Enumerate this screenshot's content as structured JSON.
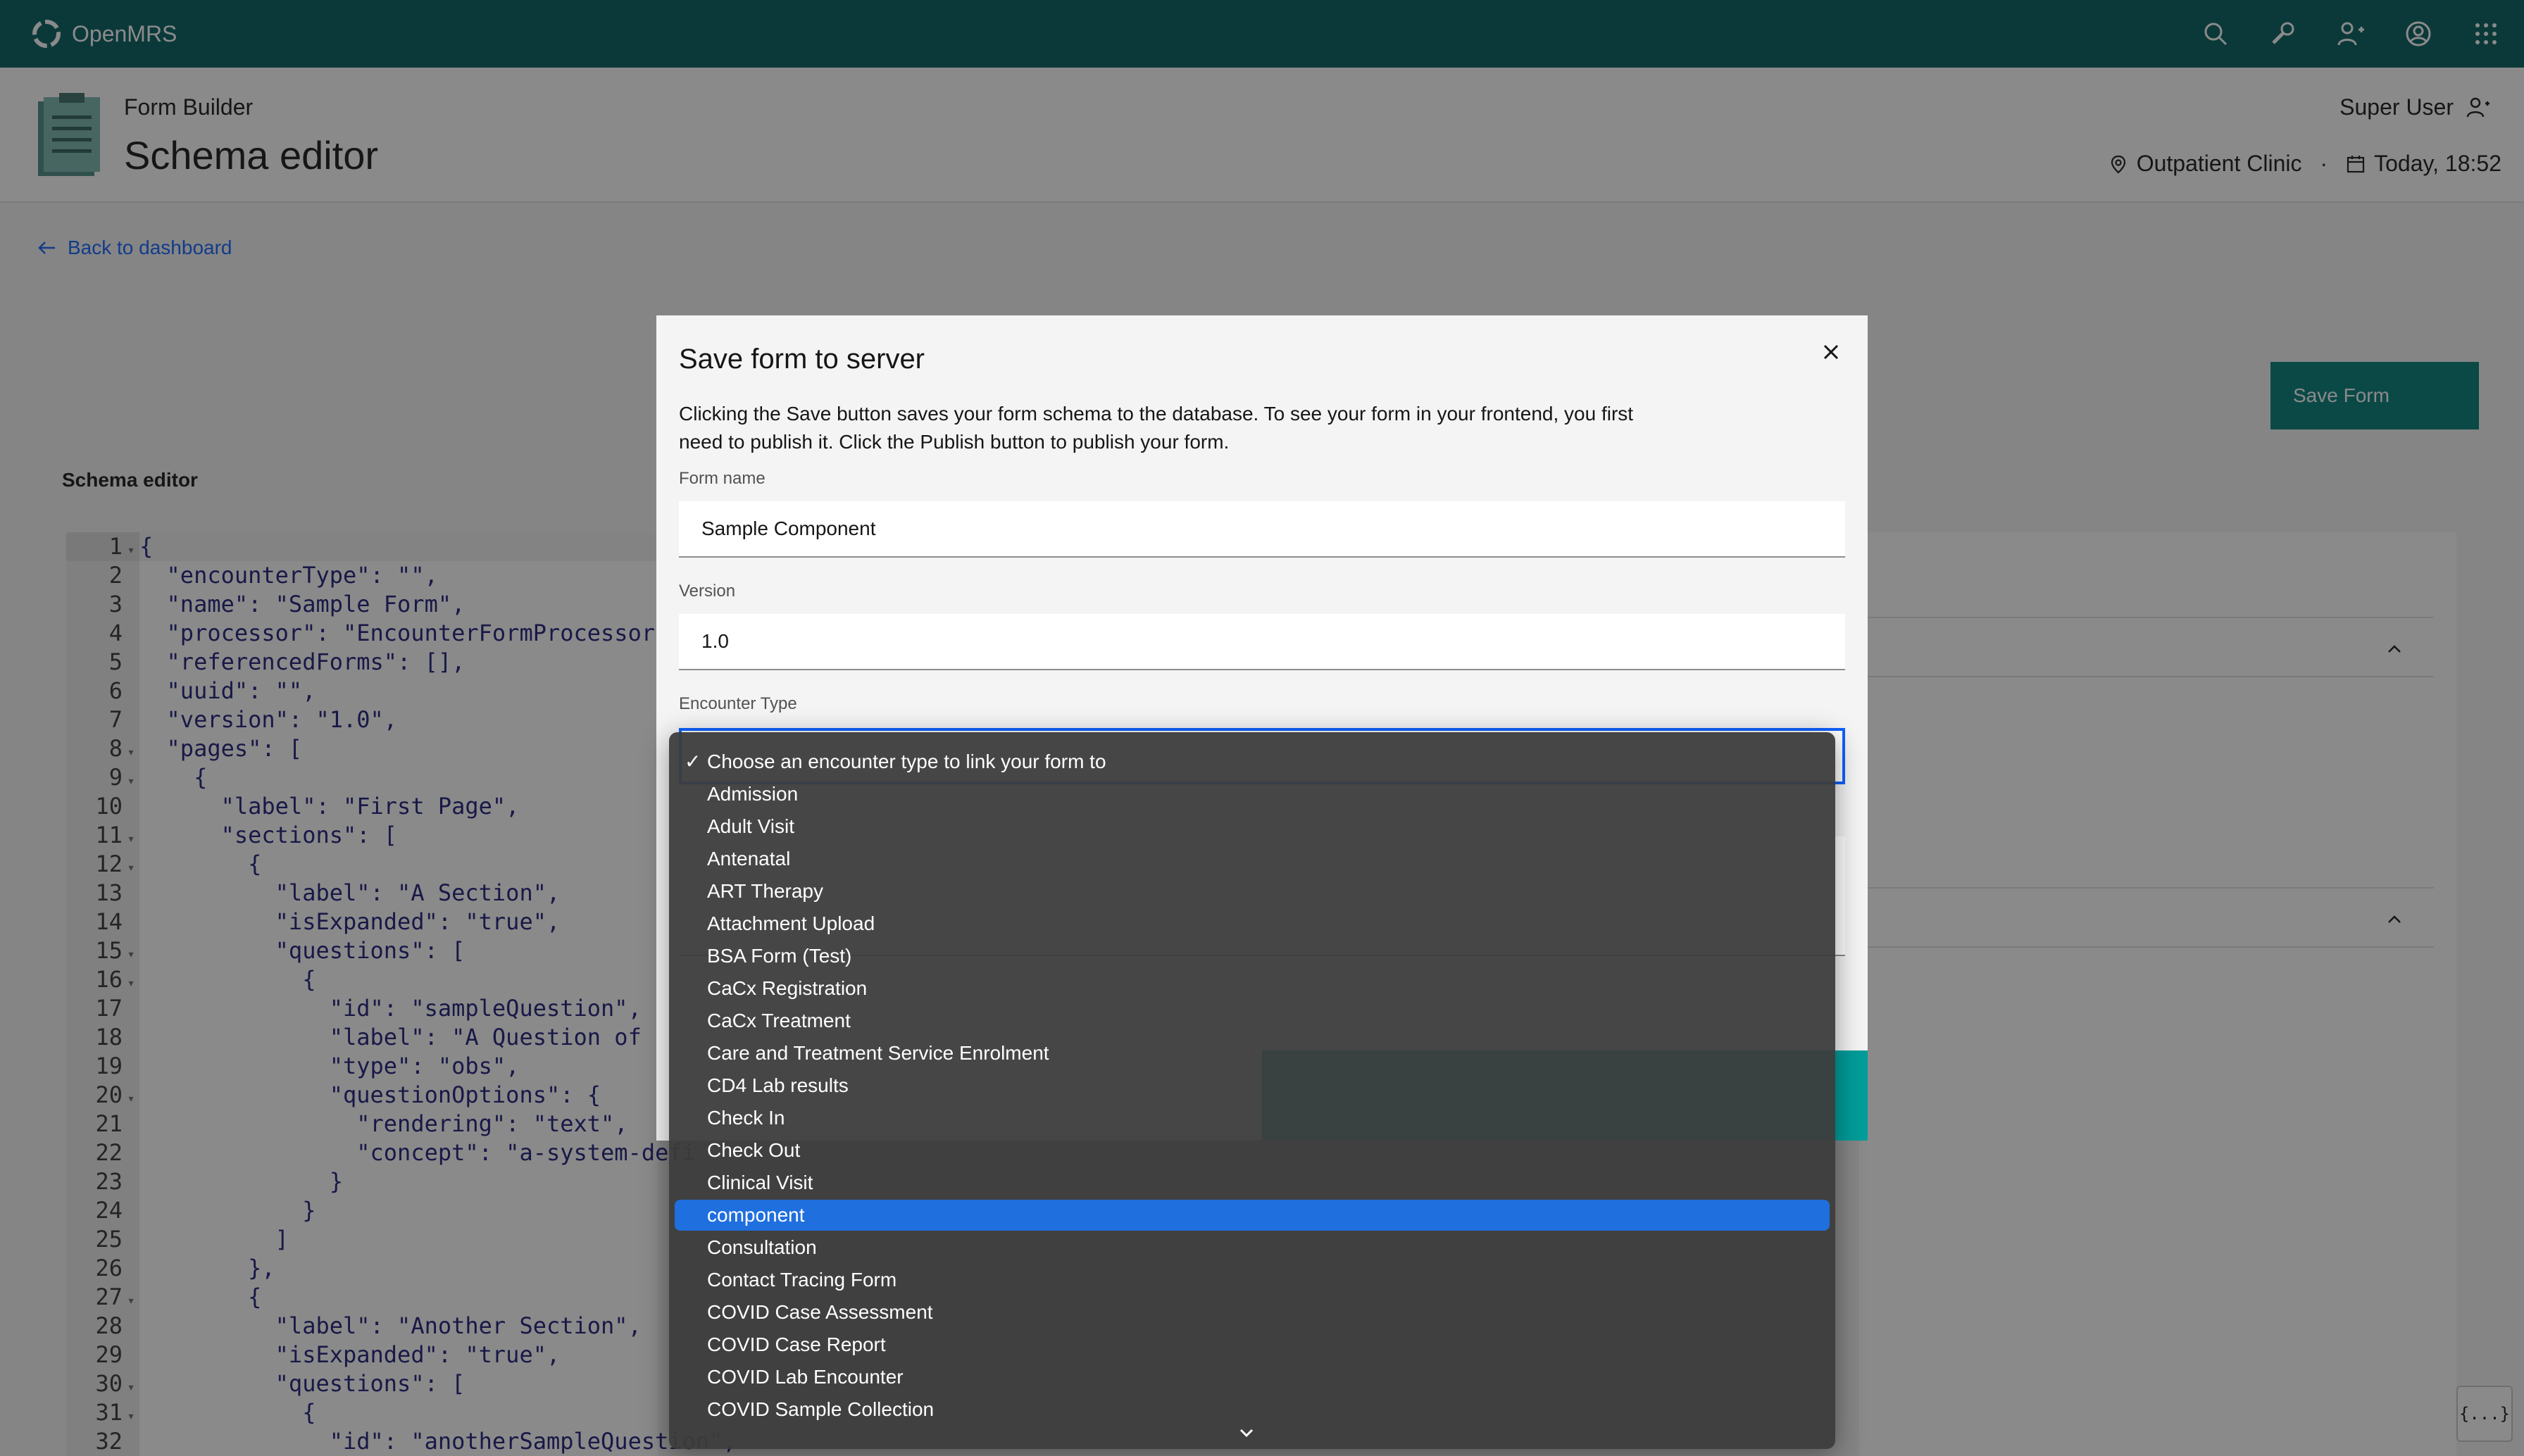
{
  "app": {
    "brand": "OpenMRS",
    "colors": {
      "nav": "#005d5d",
      "accent": "#0f62fe",
      "primary_button": "#007d79",
      "highlight": "#1f6fde"
    }
  },
  "nav": {
    "icons": [
      "search-icon",
      "wrench-icon",
      "add-patient-icon",
      "user-avatar-icon",
      "app-switcher-icon"
    ]
  },
  "header": {
    "subtitle": "Form Builder",
    "title": "Schema editor",
    "user": "Super User",
    "location": "Outpatient Clinic",
    "datetime": "Today, 18:52"
  },
  "page": {
    "back_link": "Back to dashboard",
    "save_form_button": "Save Form",
    "schema_label": "Schema editor"
  },
  "editor": {
    "lines": [
      {
        "n": "1",
        "fold": true,
        "t": "{"
      },
      {
        "n": "2",
        "fold": false,
        "t": "  \"encounterType\": \"\","
      },
      {
        "n": "3",
        "fold": false,
        "t": "  \"name\": \"Sample Form\","
      },
      {
        "n": "4",
        "fold": false,
        "t": "  \"processor\": \"EncounterFormProcessor\","
      },
      {
        "n": "5",
        "fold": false,
        "t": "  \"referencedForms\": [],"
      },
      {
        "n": "6",
        "fold": false,
        "t": "  \"uuid\": \"\","
      },
      {
        "n": "7",
        "fold": false,
        "t": "  \"version\": \"1.0\","
      },
      {
        "n": "8",
        "fold": true,
        "t": "  \"pages\": ["
      },
      {
        "n": "9",
        "fold": true,
        "t": "    {"
      },
      {
        "n": "10",
        "fold": false,
        "t": "      \"label\": \"First Page\","
      },
      {
        "n": "11",
        "fold": true,
        "t": "      \"sections\": ["
      },
      {
        "n": "12",
        "fold": true,
        "t": "        {"
      },
      {
        "n": "13",
        "fold": false,
        "t": "          \"label\": \"A Section\","
      },
      {
        "n": "14",
        "fold": false,
        "t": "          \"isExpanded\": \"true\","
      },
      {
        "n": "15",
        "fold": true,
        "t": "          \"questions\": ["
      },
      {
        "n": "16",
        "fold": true,
        "t": "            {"
      },
      {
        "n": "17",
        "fold": false,
        "t": "              \"id\": \"sampleQuestion\","
      },
      {
        "n": "18",
        "fold": false,
        "t": "              \"label\": \"A Question of ty"
      },
      {
        "n": "19",
        "fold": false,
        "t": "              \"type\": \"obs\","
      },
      {
        "n": "20",
        "fold": true,
        "t": "              \"questionOptions\": {"
      },
      {
        "n": "21",
        "fold": false,
        "t": "                \"rendering\": \"text\","
      },
      {
        "n": "22",
        "fold": false,
        "t": "                \"concept\": \"a-system-defi"
      },
      {
        "n": "23",
        "fold": false,
        "t": "              }"
      },
      {
        "n": "24",
        "fold": false,
        "t": "            }"
      },
      {
        "n": "25",
        "fold": false,
        "t": "          ]"
      },
      {
        "n": "26",
        "fold": false,
        "t": "        },"
      },
      {
        "n": "27",
        "fold": true,
        "t": "        {"
      },
      {
        "n": "28",
        "fold": false,
        "t": "          \"label\": \"Another Section\","
      },
      {
        "n": "29",
        "fold": false,
        "t": "          \"isExpanded\": \"true\","
      },
      {
        "n": "30",
        "fold": true,
        "t": "          \"questions\": ["
      },
      {
        "n": "31",
        "fold": true,
        "t": "            {"
      },
      {
        "n": "32",
        "fold": false,
        "t": "              \"id\": \"anotherSampleQuestion\","
      }
    ]
  },
  "right_panel": {
    "float_button": "{...}"
  },
  "modal": {
    "title": "Save form to server",
    "description": "Clicking the Save button saves your form schema to the database. To see your form in your frontend, you first need to publish it. Click the Publish button to publish your form.",
    "form_name_label": "Form name",
    "form_name_value": "Sample Component",
    "version_label": "Version",
    "version_value": "1.0",
    "encounter_type_label": "Encounter Type"
  },
  "dropdown": {
    "options": [
      {
        "label": "Choose an encounter type to link your form to",
        "state": "selected"
      },
      {
        "label": "Admission",
        "state": ""
      },
      {
        "label": "Adult Visit",
        "state": ""
      },
      {
        "label": "Antenatal",
        "state": ""
      },
      {
        "label": "ART Therapy",
        "state": ""
      },
      {
        "label": "Attachment Upload",
        "state": ""
      },
      {
        "label": "BSA Form (Test)",
        "state": ""
      },
      {
        "label": "CaCx Registration",
        "state": ""
      },
      {
        "label": "CaCx Treatment",
        "state": ""
      },
      {
        "label": "Care and Treatment Service Enrolment",
        "state": ""
      },
      {
        "label": "CD4 Lab results",
        "state": ""
      },
      {
        "label": "Check In",
        "state": ""
      },
      {
        "label": "Check Out",
        "state": ""
      },
      {
        "label": "Clinical Visit",
        "state": ""
      },
      {
        "label": "component",
        "state": "highlighted"
      },
      {
        "label": "Consultation",
        "state": ""
      },
      {
        "label": "Contact Tracing Form",
        "state": ""
      },
      {
        "label": "COVID Case Assessment",
        "state": ""
      },
      {
        "label": "COVID Case Report",
        "state": ""
      },
      {
        "label": "COVID Lab Encounter",
        "state": ""
      },
      {
        "label": "COVID Sample Collection",
        "state": ""
      }
    ],
    "check_mark": "✓"
  }
}
